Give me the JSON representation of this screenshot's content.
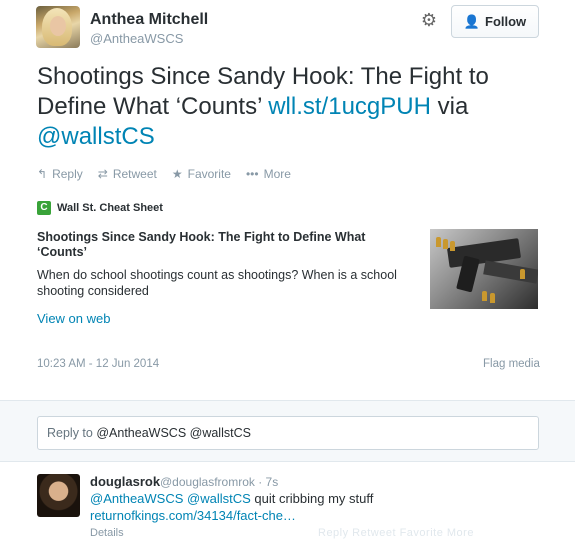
{
  "tweet": {
    "author_name": "Anthea Mitchell",
    "author_handle": "@AntheaWSCS",
    "follow_label": "Follow",
    "text_plain": "Shootings Since Sandy Hook: The Fight to Define What ‘Counts’ ",
    "text_link": "wll.st/1ucgPUH",
    "text_via": " via ",
    "text_mention": "@wallstCS",
    "actions": {
      "reply": "Reply",
      "retweet": "Retweet",
      "favorite": "Favorite",
      "more": "More"
    },
    "timestamp": "10:23 AM - 12 Jun 2014",
    "flag_media": "Flag media"
  },
  "card": {
    "source_logo": "C",
    "source_name": "Wall St. Cheat Sheet",
    "title": "Shootings Since Sandy Hook: The Fight to Define What ‘Counts’",
    "description": "When do school shootings count as shootings? When is a school shooting considered",
    "view_on_web": "View on web"
  },
  "reply_box": {
    "prefix": "Reply to ",
    "mention1": "@AntheaWSCS",
    "mention2": " @wallstCS"
  },
  "reply_tweet": {
    "author_name": "douglasrok",
    "meta": "@douglasfromrok · 7s",
    "mention1": "@AntheaWSCS",
    "mention2": " @wallstCS",
    "text": " quit cribbing my stuff ",
    "link": "returnofkings.com/34134/fact-che…",
    "details": "Details",
    "faint_actions": "Reply    Retweet    Favorite    More"
  },
  "icons": {
    "settings": "gear-icon",
    "follow": "person-add-icon",
    "reply": "reply-arrow-icon",
    "retweet": "retweet-icon",
    "favorite": "star-icon",
    "more": "ellipsis-icon"
  },
  "colors": {
    "link": "#0084b4",
    "muted": "#8899a6",
    "text": "#292f33",
    "follow_icon": "#55acee",
    "source_logo": "#39a339"
  }
}
